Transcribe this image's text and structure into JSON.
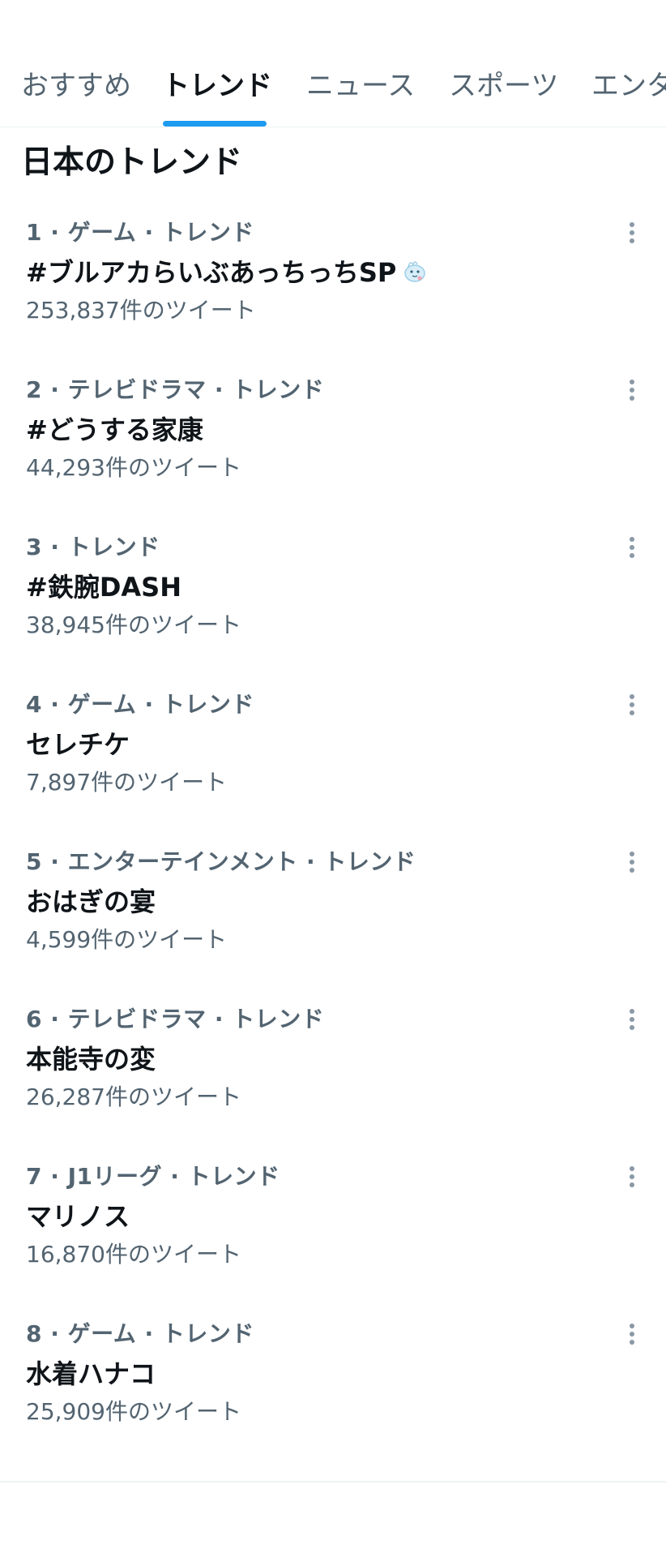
{
  "tabs": [
    {
      "label": "おすすめ",
      "active": false
    },
    {
      "label": "トレンド",
      "active": true
    },
    {
      "label": "ニュース",
      "active": false
    },
    {
      "label": "スポーツ",
      "active": false
    },
    {
      "label": "エンタ",
      "active": false
    }
  ],
  "section_title": "日本のトレンド",
  "trends": [
    {
      "meta": "1 · ゲーム · トレンド",
      "name": "#ブルアカらいぶあっちっちSP",
      "count": "253,837件のツイート",
      "emoji": "whale-emoji"
    },
    {
      "meta": "2 · テレビドラマ · トレンド",
      "name": "#どうする家康",
      "count": "44,293件のツイート"
    },
    {
      "meta": "3 · トレンド",
      "name": "#鉄腕DASH",
      "count": "38,945件のツイート"
    },
    {
      "meta": "4 · ゲーム · トレンド",
      "name": "セレチケ",
      "count": "7,897件のツイート"
    },
    {
      "meta": "5 · エンターテインメント · トレンド",
      "name": "おはぎの宴",
      "count": "4,599件のツイート"
    },
    {
      "meta": "6 · テレビドラマ · トレンド",
      "name": "本能寺の変",
      "count": "26,287件のツイート"
    },
    {
      "meta": "7 · J1リーグ · トレンド",
      "name": "マリノス",
      "count": "16,870件のツイート"
    },
    {
      "meta": "8 · ゲーム · トレンド",
      "name": "水着ハナコ",
      "count": "25,909件のツイート"
    }
  ],
  "colors": {
    "accent": "#1d9bf0",
    "text_primary": "#0f1419",
    "text_secondary": "#536471",
    "divider": "#eff3f4"
  }
}
